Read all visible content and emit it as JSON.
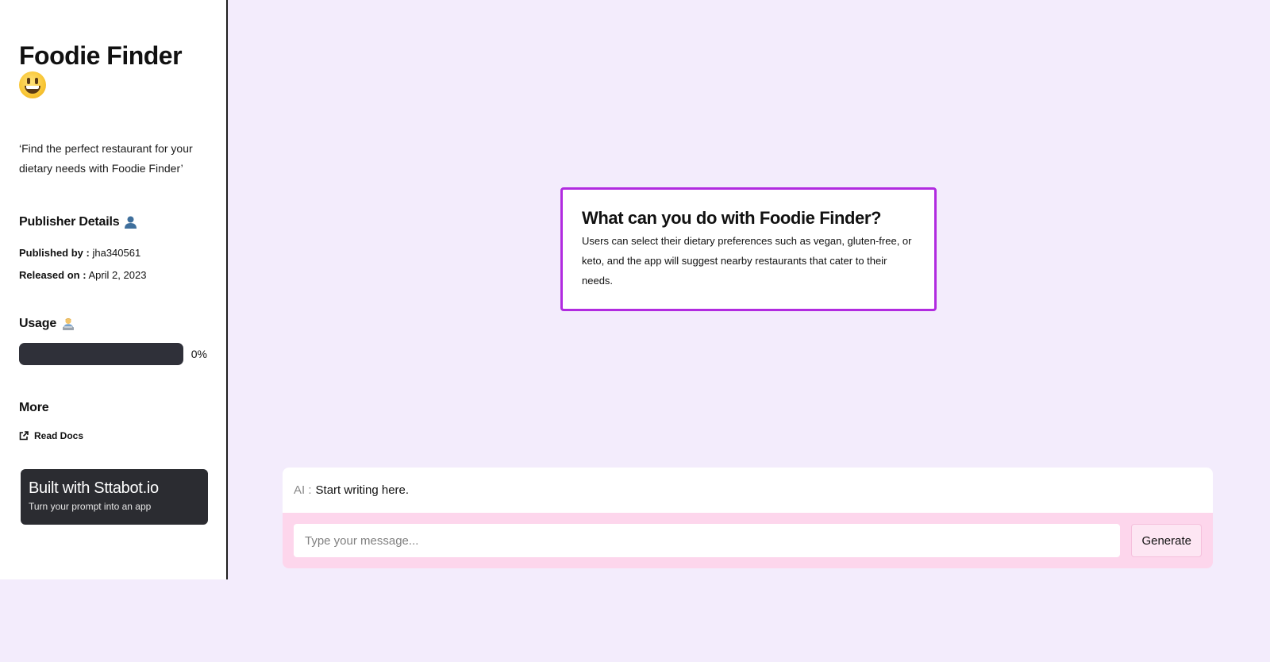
{
  "sidebar": {
    "title": "Foodie Finder",
    "title_emoji": "grinning-face",
    "tagline": "‘Find the perfect restaurant for your dietary needs with Foodie Finder’",
    "publisher": {
      "heading": "Publisher Details",
      "heading_icon": "person-icon",
      "published_by_label": "Published by :",
      "published_by_value": "jha340561",
      "released_on_label": "Released on :",
      "released_on_value": "April 2, 2023"
    },
    "usage": {
      "heading": "Usage",
      "heading_icon": "technologist-icon",
      "percent_value": 0,
      "percent_text": "0%"
    },
    "more": {
      "heading": "More",
      "read_docs_label": "Read Docs"
    },
    "built_with": {
      "title": "Built with Sttabot.io",
      "subtitle": "Turn your prompt into an app"
    }
  },
  "info_card": {
    "title": "What can you do with Foodie Finder?",
    "body": "Users can select their dietary preferences such as vegan, gluten-free, or keto, and the app will suggest nearby restaurants that cater to their needs."
  },
  "chat": {
    "ai_label": "AI :",
    "ai_text": "Start writing here.",
    "input_placeholder": "Type your message...",
    "input_value": "",
    "generate_label": "Generate"
  },
  "colors": {
    "page_background": "#f3ecfc",
    "card_border": "#b12be0",
    "usage_bar": "#2f3039",
    "input_row_background": "#fdd6ec",
    "built_card_background": "#2b2c31"
  }
}
